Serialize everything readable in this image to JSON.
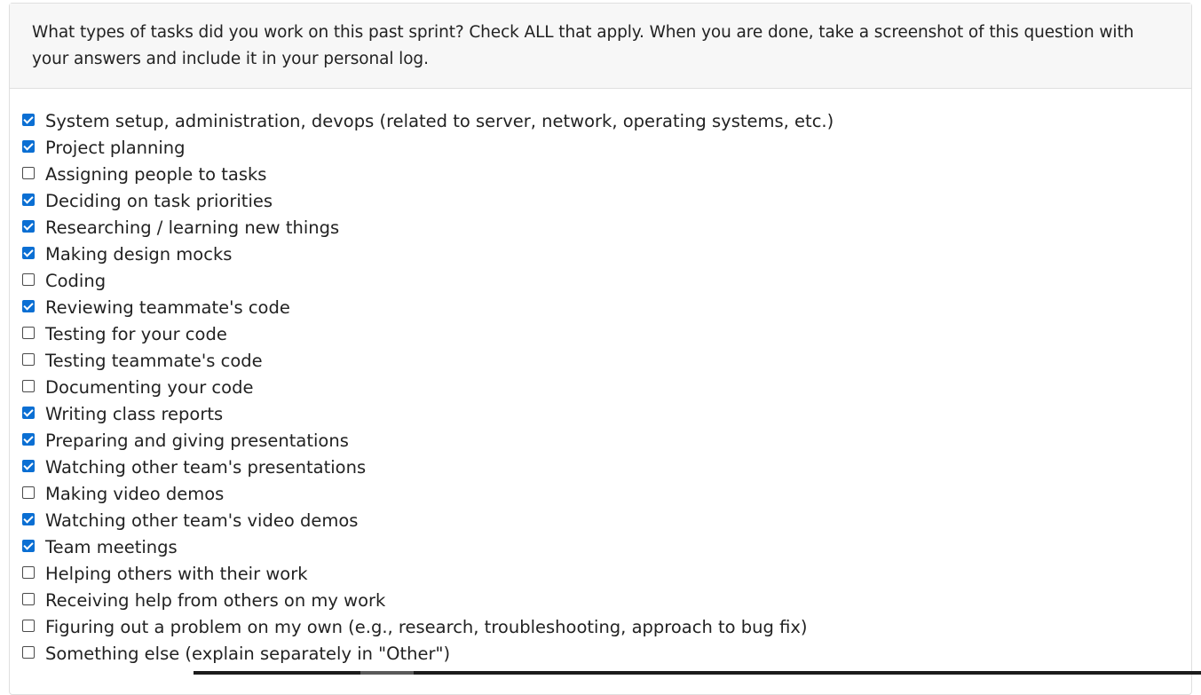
{
  "question": {
    "text": "What types of tasks did you work on this past sprint? Check ALL that apply. When you are done, take a screenshot of this question with your answers and include it in your personal log."
  },
  "options": [
    {
      "label": "System setup, administration, devops (related to server, network, operating systems, etc.)",
      "checked": true
    },
    {
      "label": "Project planning",
      "checked": true
    },
    {
      "label": "Assigning people to tasks",
      "checked": false
    },
    {
      "label": "Deciding on task priorities",
      "checked": true
    },
    {
      "label": "Researching / learning new things",
      "checked": true
    },
    {
      "label": "Making design mocks",
      "checked": true
    },
    {
      "label": "Coding",
      "checked": false
    },
    {
      "label": "Reviewing teammate's code",
      "checked": true
    },
    {
      "label": "Testing for your code",
      "checked": false
    },
    {
      "label": "Testing teammate's code",
      "checked": false
    },
    {
      "label": "Documenting your code",
      "checked": false
    },
    {
      "label": "Writing class reports",
      "checked": true
    },
    {
      "label": "Preparing and giving presentations",
      "checked": true
    },
    {
      "label": "Watching other team's presentations",
      "checked": true
    },
    {
      "label": "Making video demos",
      "checked": false
    },
    {
      "label": "Watching other team's video demos",
      "checked": true
    },
    {
      "label": "Team meetings",
      "checked": true
    },
    {
      "label": "Helping others with their work",
      "checked": false
    },
    {
      "label": "Receiving help from others on my work",
      "checked": false
    },
    {
      "label": "Figuring out a problem on my own (e.g., research, troubleshooting, approach to bug fix)",
      "checked": false
    },
    {
      "label": "Something else (explain separately in \"Other\")",
      "checked": false
    }
  ],
  "colors": {
    "checkbox_checked": "#0b6fd3",
    "header_bg": "#f7f7f7"
  }
}
